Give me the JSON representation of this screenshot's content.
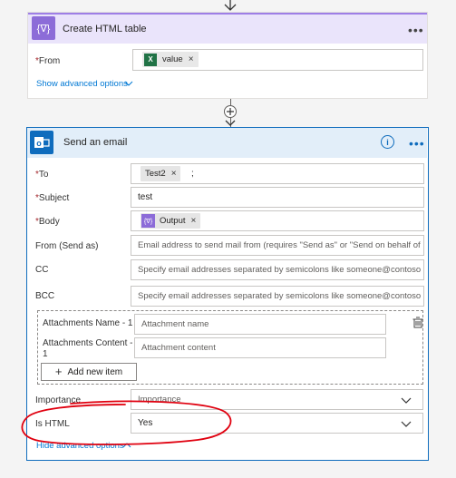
{
  "top_card": {
    "title": "Create HTML table",
    "more_label": "•••",
    "icon": "data-operation-icon",
    "accent_color": "#9e7ee6",
    "from": {
      "required": "*",
      "label": "From",
      "token": "value",
      "token_icon": "excel-icon",
      "token_remove": "×"
    },
    "advanced_link": "Show advanced options"
  },
  "email_card": {
    "title": "Send an email",
    "more_label": "•••",
    "icon": "outlook-icon",
    "info_icon": "info-icon",
    "accent_color": "#0f6cbd",
    "fields": {
      "to": {
        "required": "*",
        "label": "To",
        "token": "Test2",
        "token_remove": "×",
        "suffix": ";"
      },
      "subject": {
        "required": "*",
        "label": "Subject",
        "value": "test"
      },
      "body": {
        "required": "*",
        "label": "Body",
        "token": "Output",
        "token_remove": "×"
      },
      "from_send_as": {
        "label": "From (Send as)",
        "placeholder": "Email address to send mail from (requires \"Send as\" or \"Send on behalf of\" pe"
      },
      "cc": {
        "label": "CC",
        "placeholder": "Specify email addresses separated by semicolons like someone@contoso.com"
      },
      "bcc": {
        "label": "BCC",
        "placeholder": "Specify email addresses separated by semicolons like someone@contoso.com"
      }
    },
    "attachments": {
      "name_label": "Attachments Name - 1",
      "name_placeholder": "Attachment name",
      "content_label_line1": "Attachments Content -",
      "content_label_line2": "1",
      "content_placeholder": "Attachment content",
      "add_button_label": "Add new item",
      "delete_icon": "delete-item-icon"
    },
    "importance": {
      "label": "Importance",
      "value": "Importance"
    },
    "is_html": {
      "label": "Is HTML",
      "value": "Yes",
      "highlight_color": "#e0000f"
    },
    "advanced_link": "Hide advanced options"
  },
  "connector_icons": [
    "arrow-down-icon",
    "add-step-icon"
  ]
}
